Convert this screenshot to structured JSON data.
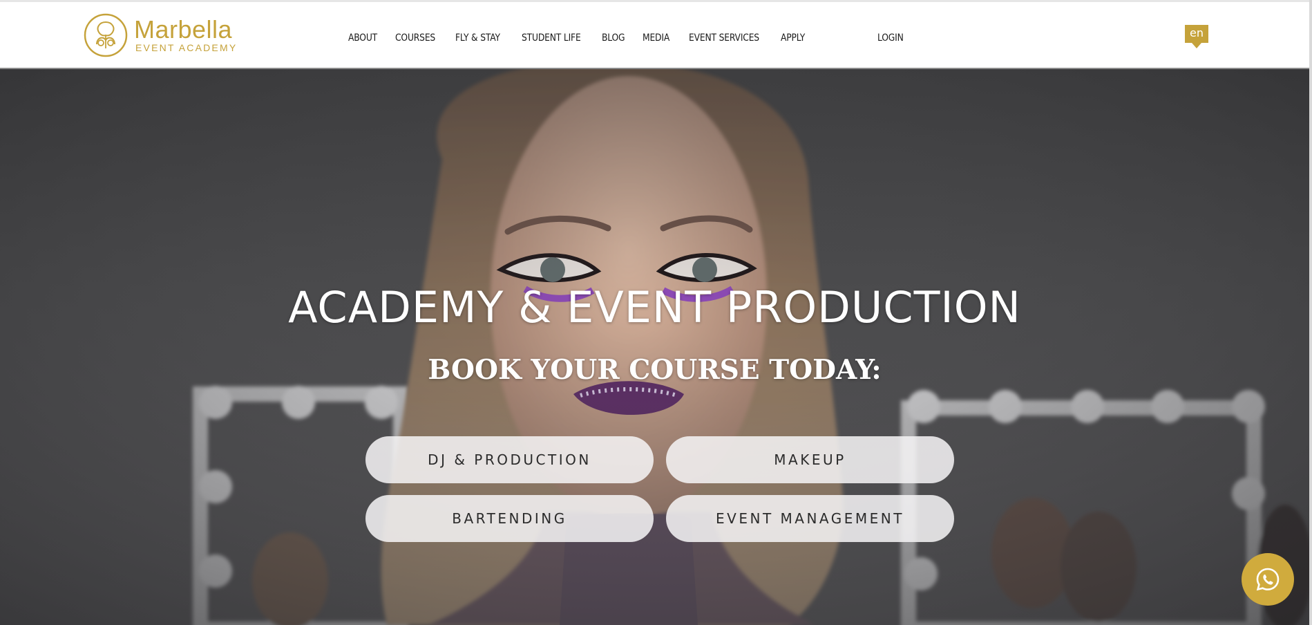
{
  "brand": {
    "name": "Marbella",
    "subtitle": "EVENT ACADEMY",
    "color": "#c5a23a"
  },
  "nav": {
    "items": [
      {
        "label": "ABOUT"
      },
      {
        "label": "COURSES"
      },
      {
        "label": "FLY & STAY"
      },
      {
        "label": "STUDENT LIFE"
      },
      {
        "label": "BLOG"
      },
      {
        "label": "MEDIA"
      },
      {
        "label": "EVENT SERVICES"
      },
      {
        "label": "APPLY"
      }
    ],
    "login_label": "LOGIN"
  },
  "language": {
    "current": "en"
  },
  "hero": {
    "title": "ACADEMY & EVENT PRODUCTION",
    "subtitle": "BOOK YOUR COURSE TODAY:",
    "courses": [
      {
        "label": "DJ & PRODUCTION"
      },
      {
        "label": "MAKEUP"
      },
      {
        "label": "BARTENDING"
      },
      {
        "label": "EVENT MANAGEMENT"
      }
    ]
  },
  "chat": {
    "icon": "whatsapp-icon",
    "color": "#d0ab3d"
  }
}
